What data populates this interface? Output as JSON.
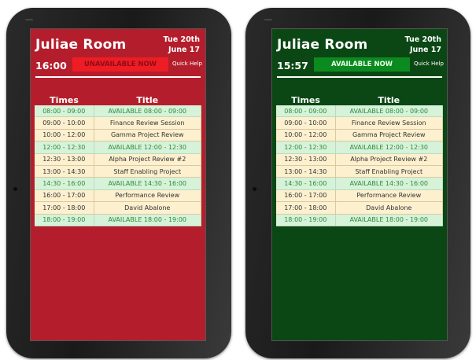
{
  "panels": [
    {
      "room": "Juliae Room",
      "date_line1": "Tue 20th",
      "date_line2": "June 17",
      "time": "16:00",
      "status": "UNAVAILABLE NOW",
      "help": "Quick Help",
      "status_color": "#ee1c25",
      "background_color": "#b41e2c"
    },
    {
      "room": "Juliae Room",
      "date_line1": "Tue 20th",
      "date_line2": "June 17",
      "time": "15:57",
      "status": "AVAILABLE NOW",
      "help": "Quick Help",
      "status_color": "#0b8a1f",
      "background_color": "#0a4714"
    }
  ],
  "schedule": {
    "headers": {
      "times": "Times",
      "title": "Title"
    },
    "rows": [
      {
        "time": "08:00 - 09:00",
        "title": "AVAILABLE 08:00 - 09:00",
        "state": "free"
      },
      {
        "time": "09:00 - 10:00",
        "title": "Finance Review Session",
        "state": "booked"
      },
      {
        "time": "10:00 - 12:00",
        "title": "Gamma Project Review",
        "state": "booked"
      },
      {
        "time": "12:00 - 12:30",
        "title": "AVAILABLE 12:00 - 12:30",
        "state": "free"
      },
      {
        "time": "12:30 - 13:00",
        "title": "Alpha Project Review #2",
        "state": "booked"
      },
      {
        "time": "13:00 - 14:30",
        "title": "Staff Enabling Project",
        "state": "booked"
      },
      {
        "time": "14:30 - 16:00",
        "title": "AVAILABLE 14:30 - 16:00",
        "state": "free"
      },
      {
        "time": "16:00 - 17:00",
        "title": "Performance Review",
        "state": "booked"
      },
      {
        "time": "17:00 - 18:00",
        "title": "David Abalone",
        "state": "booked"
      },
      {
        "time": "18:00 - 19:00",
        "title": "AVAILABLE 18:00 - 19:00",
        "state": "free"
      }
    ]
  }
}
